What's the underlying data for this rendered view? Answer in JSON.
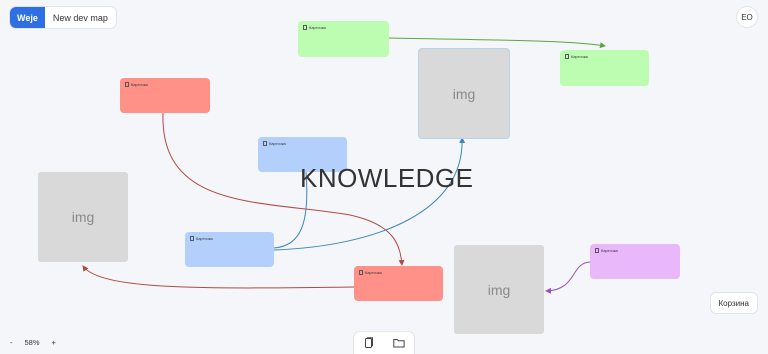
{
  "header": {
    "logo": "Weje",
    "map_name": "New dev map",
    "avatar_initials": "EO"
  },
  "board": {
    "center_text": "KNOWLEDGE",
    "cards": [
      {
        "name": "card-green-top",
        "label": "Карточка",
        "color": "#bdfdb2"
      },
      {
        "name": "card-green-right",
        "label": "Карточка",
        "color": "#bdfdb2"
      },
      {
        "name": "card-red-top",
        "label": "Карточка",
        "color": "#ff9189"
      },
      {
        "name": "card-blue-middle",
        "label": "Карточка",
        "color": "#b3d0fd"
      },
      {
        "name": "card-blue-bottom",
        "label": "Карточка",
        "color": "#b3d0fd"
      },
      {
        "name": "card-red-bottom",
        "label": "Карточка",
        "color": "#ff9189"
      },
      {
        "name": "card-purple",
        "label": "Карточка",
        "color": "#e9b8fb"
      }
    ],
    "images": [
      {
        "name": "image-top",
        "label": "img"
      },
      {
        "name": "image-left",
        "label": "img"
      },
      {
        "name": "image-bottom-right",
        "label": "img"
      }
    ],
    "connector_colors": {
      "green": "#5aa640",
      "red": "#b04a44",
      "blue": "#3e86b8",
      "purple": "#9b4fc0"
    }
  },
  "controls": {
    "zoom_out": "-",
    "zoom_level": "58%",
    "zoom_in": "+",
    "basket_label": "Корзина",
    "tools": [
      "document-icon",
      "folder-icon"
    ]
  }
}
